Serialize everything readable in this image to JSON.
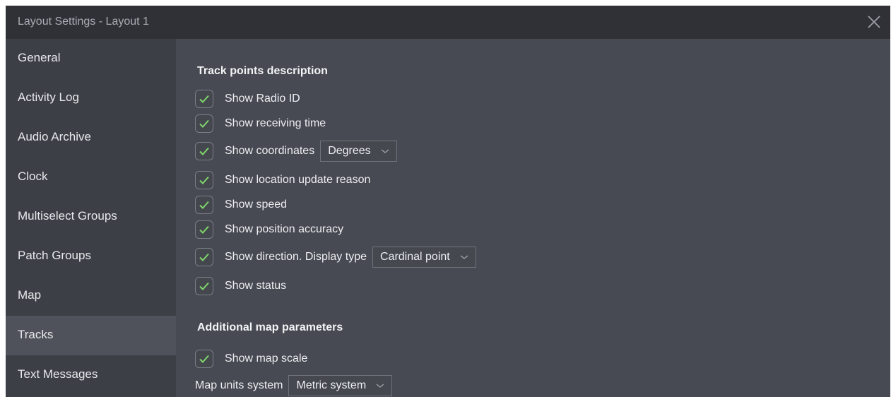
{
  "window": {
    "title": "Layout Settings - Layout 1",
    "close_icon": "close-icon"
  },
  "sidebar": {
    "items": [
      {
        "label": "General"
      },
      {
        "label": "Activity Log"
      },
      {
        "label": "Audio Archive"
      },
      {
        "label": "Clock"
      },
      {
        "label": "Multiselect Groups"
      },
      {
        "label": "Patch Groups"
      },
      {
        "label": "Map"
      },
      {
        "label": "Tracks",
        "active": true
      },
      {
        "label": "Text Messages"
      }
    ]
  },
  "track_points": {
    "heading": "Track points description",
    "options": [
      {
        "label": "Show Radio ID",
        "checked": true
      },
      {
        "label": "Show receiving time",
        "checked": true
      },
      {
        "label": "Show coordinates",
        "checked": true,
        "select": "Degrees"
      },
      {
        "label": "Show location update reason",
        "checked": true
      },
      {
        "label": "Show speed",
        "checked": true
      },
      {
        "label": "Show position accuracy",
        "checked": true
      },
      {
        "label": "Show direction. Display type",
        "checked": true,
        "select": "Cardinal point"
      },
      {
        "label": "Show status",
        "checked": true
      }
    ]
  },
  "map_params": {
    "heading": "Additional map parameters",
    "show_scale": {
      "label": "Show map scale",
      "checked": true
    },
    "units": {
      "label": "Map units system",
      "select": "Metric system"
    }
  },
  "colors": {
    "accent_check": "#7fd66a",
    "window_bg": "#474a52",
    "titlebar_bg": "#2f3137",
    "sidebar_bg": "#3c3f46"
  }
}
